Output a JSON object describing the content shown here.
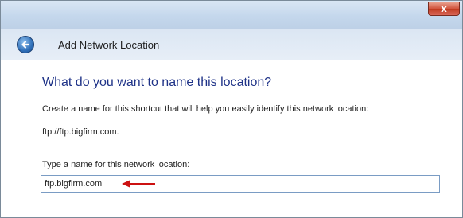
{
  "window": {
    "close_label": "x",
    "title": "Add Network Location"
  },
  "main": {
    "heading": "What do you want to name this location?",
    "description": "Create a name for this shortcut that will help you easily identify this network location:",
    "address": "ftp://ftp.bigfirm.com.",
    "field_label": "Type a name for this network location:",
    "field_value": "ftp.bigfirm.com"
  },
  "colors": {
    "heading": "#1e3287",
    "annotation_arrow": "#cc1111"
  },
  "icons": {
    "back": "back-arrow-icon",
    "close": "close-icon"
  }
}
